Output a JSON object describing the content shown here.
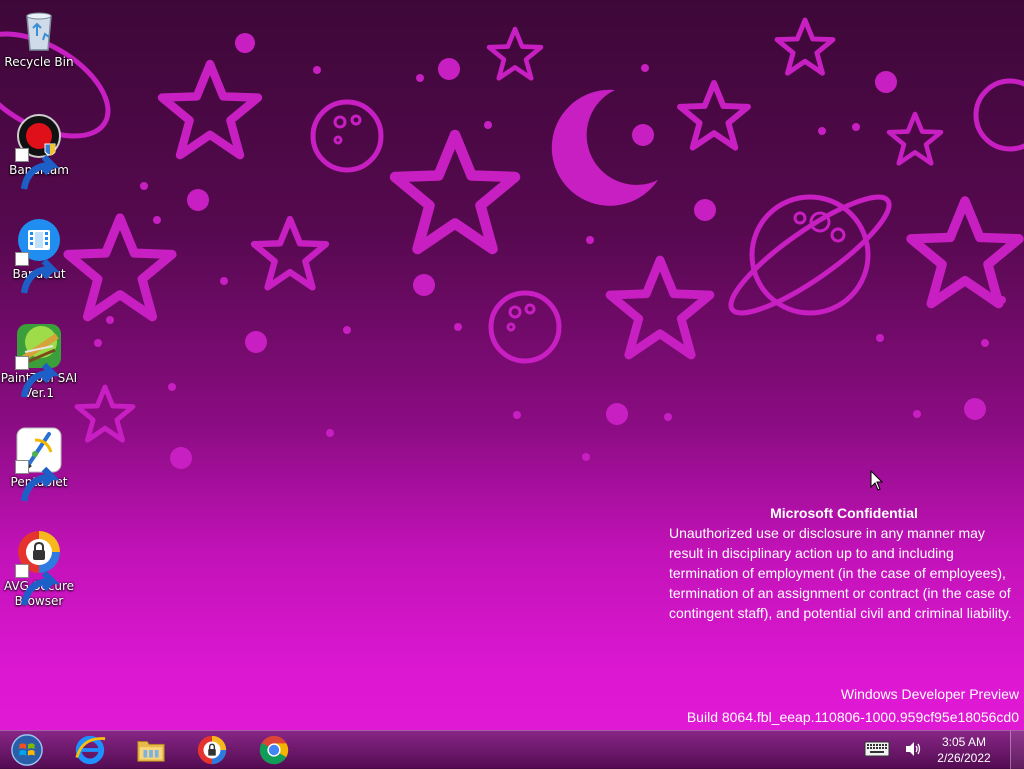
{
  "desktop": {
    "icons": [
      {
        "label": "Recycle Bin",
        "icon": "recycle-bin-icon"
      },
      {
        "label": "Bandicam",
        "icon": "bandicam-icon"
      },
      {
        "label": "Bandicut",
        "icon": "bandicut-icon"
      },
      {
        "label": "PaintTool SAI Ver.1",
        "icon": "painttool-sai-icon"
      },
      {
        "label": "Pentablet",
        "icon": "pentablet-icon"
      },
      {
        "label": "AVG Secure Browser",
        "icon": "avg-secure-browser-icon"
      }
    ]
  },
  "watermark": {
    "title": "Microsoft Confidential",
    "body": "Unauthorized use or disclosure in any manner may result in disciplinary action up to and including termination of employment (in the case of employees), termination of an assignment or contract (in the case of contingent staff), and potential civil and criminal liability."
  },
  "build": {
    "line1": "Windows Developer Preview",
    "line2": "Build 8064.fbl_eeap.110806-1000.959cf95e18056cd0"
  },
  "taskbar": {
    "pinned": [
      {
        "icon": "internet-explorer-icon"
      },
      {
        "icon": "file-explorer-icon"
      },
      {
        "icon": "avg-secure-browser-icon"
      },
      {
        "icon": "chrome-icon"
      }
    ],
    "clock": {
      "time": "3:05 AM",
      "date": "2/26/2022"
    }
  },
  "colors": {
    "wallpaper_top": "#3d0838",
    "wallpaper_bottom": "#e21ad6",
    "motif": "#c81fc2"
  }
}
